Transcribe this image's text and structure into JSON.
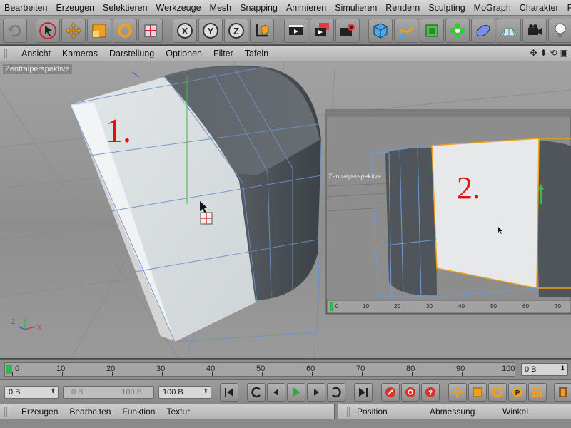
{
  "menubar": {
    "items": [
      "Bearbeiten",
      "Erzeugen",
      "Selektieren",
      "Werkzeuge",
      "Mesh",
      "Snapping",
      "Animieren",
      "Simulieren",
      "Rendern",
      "Sculpting",
      "MoGraph",
      "Charakter",
      "Pl"
    ]
  },
  "toolbar": {
    "buttons": [
      "undo-icon",
      "select-arrow-icon",
      "move-icon",
      "scale-icon",
      "rotate-icon",
      "live-select-icon",
      "x-axis-icon",
      "y-axis-icon",
      "z-axis-icon",
      "coordinate-system-icon",
      "render-view-icon",
      "render-picture-viewer-icon",
      "render-settings-icon",
      "cube-icon",
      "spline-icon",
      "subdivision-icon",
      "mograph-cloner-icon",
      "deformer-icon",
      "floor-icon",
      "camera-icon",
      "light-icon"
    ],
    "axis_labels": {
      "x": "X",
      "y": "Y",
      "z": "Z"
    }
  },
  "viewport_menu": {
    "items": [
      "Ansicht",
      "Kameras",
      "Darstellung",
      "Optionen",
      "Filter",
      "Tafeln"
    ],
    "nav_icons": [
      "move-view-icon",
      "dolly-view-icon",
      "rotate-view-icon",
      "maximize-view-icon"
    ]
  },
  "viewport": {
    "label": "Zentralperspektive",
    "annotation_1": "1.",
    "annotation_2": "2.",
    "annotation_color": "#e41010",
    "axis_labels": {
      "y": "Y",
      "x": "X",
      "z": "Z"
    },
    "inset": {
      "label": "Zentralperspektive",
      "ruler_labels": [
        "0",
        "10",
        "20",
        "30",
        "40",
        "50",
        "60",
        "70"
      ]
    }
  },
  "timeline": {
    "labels": [
      "0",
      "10",
      "20",
      "30",
      "40",
      "50",
      "60",
      "70",
      "80",
      "90",
      "100"
    ],
    "current_frame": "0 B"
  },
  "transport": {
    "start_frame": "0 B",
    "range_start": "0 B",
    "range_end": "100 B",
    "end_frame": "100 B",
    "play_color": "#2ab03a",
    "record_color": "#d8302a"
  },
  "bottom": {
    "material_menu": [
      "Erzeugen",
      "Bearbeiten",
      "Funktion",
      "Textur"
    ],
    "coord_headers": [
      "Position",
      "Abmessung",
      "Winkel"
    ]
  }
}
